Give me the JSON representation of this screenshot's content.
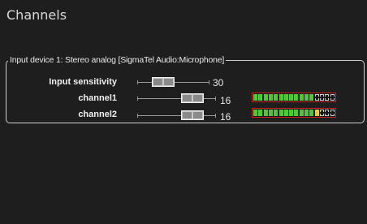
{
  "window": {
    "title": "Channels"
  },
  "input_group": {
    "legend": "Input device 1: Stereo analog [SigmaTel Audio:Microphone]",
    "sensitivity": {
      "label": "Input sensitivity",
      "value": "30"
    },
    "channels": [
      {
        "label": "channel1",
        "value": "16",
        "meter_level": 0.78
      },
      {
        "label": "channel2",
        "value": "16",
        "meter_level": 0.82
      }
    ]
  },
  "colors": {
    "meter_green": "#4cc832",
    "meter_yellow": "#e6c83c",
    "meter_off": "#e6e6e6",
    "meter_border": "#cc2020"
  }
}
